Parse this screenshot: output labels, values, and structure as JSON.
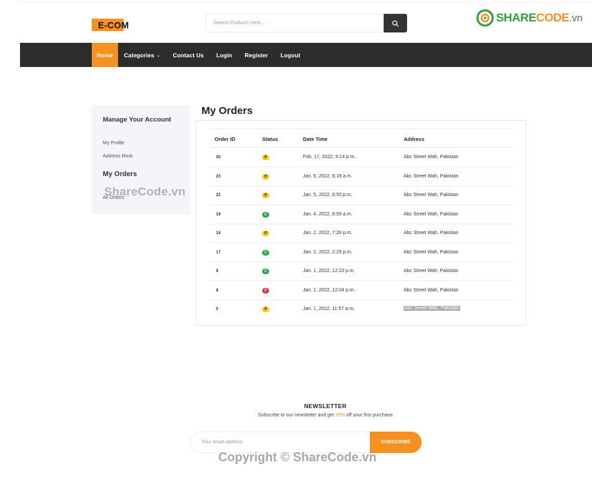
{
  "header": {
    "logo_text": "E-COM",
    "search_placeholder": "Search Products Here....",
    "search_icon": "search-icon"
  },
  "watermark": {
    "brand_main": "SHARE",
    "brand_code": "CODE",
    "brand_tld": ".vn",
    "mid_text": "ShareCode.vn",
    "copyright_text": "Copyright © ShareCode.vn"
  },
  "nav": {
    "items": [
      {
        "label": "Home"
      },
      {
        "label": "Categories"
      },
      {
        "label": "Contact Us"
      },
      {
        "label": "Login"
      },
      {
        "label": "Register"
      },
      {
        "label": "Logout"
      }
    ]
  },
  "sidebar": {
    "title": "Manage Your Account",
    "links": [
      {
        "label": "My Profile"
      },
      {
        "label": "Address Book"
      }
    ],
    "orders_heading": "My Orders",
    "orders_link": "All Orders"
  },
  "orders": {
    "title": "My Orders",
    "columns": [
      "Order ID",
      "Status",
      "Date Time",
      "Address"
    ],
    "status_colors": {
      "P": "#f5c518",
      "C": "#28a745",
      "F": "#dc3545"
    },
    "rows": [
      {
        "id": "25",
        "status": "P",
        "datetime": "Feb. 17, 2022, 9:14 p.m.",
        "address": "Abc Street Wah, Pakistan"
      },
      {
        "id": "23",
        "status": "P",
        "datetime": "Jan. 6, 2022, 6:18 a.m.",
        "address": "Abc Street Wah, Pakistan"
      },
      {
        "id": "22",
        "status": "P",
        "datetime": "Jan. 5, 2022, 6:55 p.m.",
        "address": "Abc Street Wah, Pakistan"
      },
      {
        "id": "19",
        "status": "C",
        "datetime": "Jan. 4, 2022, 8:59 a.m.",
        "address": "Abc Street Wah, Pakistan"
      },
      {
        "id": "18",
        "status": "P",
        "datetime": "Jan. 2, 2022, 7:28 p.m.",
        "address": "Abc Street Wah, Pakistan"
      },
      {
        "id": "17",
        "status": "C",
        "datetime": "Jan. 2, 2022, 2:29 p.m.",
        "address": "Abc Street Wah, Pakistan"
      },
      {
        "id": "9",
        "status": "C",
        "datetime": "Jan. 1, 2022, 12:23 p.m.",
        "address": "Abc Street Wah, Pakistan"
      },
      {
        "id": "8",
        "status": "F",
        "datetime": "Jan. 1, 2022, 12:04 p.m.",
        "address": "Abc Street Wah, Pakistan"
      },
      {
        "id": "5",
        "status": "P",
        "datetime": "Jan. 1, 2022, 11:57 a.m.",
        "address": "Abc Street Wah, Pakistan"
      }
    ]
  },
  "newsletter": {
    "title": "NEWSLETTER",
    "subtitle_before": "Subscribe to our newsletter and get ",
    "subtitle_highlight": "10%",
    "subtitle_after": " off your first purchase",
    "email_placeholder": "Your email address",
    "button_label": "SUBSCRIBE"
  },
  "colors": {
    "accent": "#f6901e",
    "nav_bg": "#2c2c2c",
    "sidebar_bg": "#f4f5f9"
  }
}
